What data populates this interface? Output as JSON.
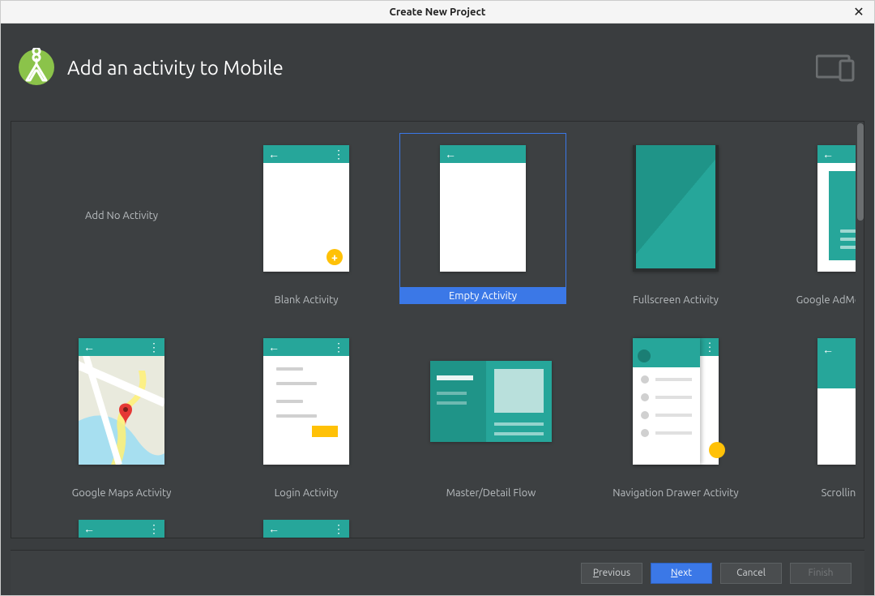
{
  "window": {
    "title": "Create New Project"
  },
  "header": {
    "title": "Add an activity to Mobile"
  },
  "templates": [
    {
      "key": "add_no_activity",
      "label": "Add No Activity",
      "selected": false
    },
    {
      "key": "blank",
      "label": "Blank Activity",
      "selected": false
    },
    {
      "key": "empty",
      "label": "Empty Activity",
      "selected": true
    },
    {
      "key": "fullscreen",
      "label": "Fullscreen Activity",
      "selected": false
    },
    {
      "key": "admob",
      "label": "Google AdMob Ads Activity",
      "selected": false
    },
    {
      "key": "maps",
      "label": "Google Maps Activity",
      "selected": false
    },
    {
      "key": "login",
      "label": "Login Activity",
      "selected": false
    },
    {
      "key": "master_detail",
      "label": "Master/Detail Flow",
      "selected": false
    },
    {
      "key": "nav_drawer",
      "label": "Navigation Drawer Activity",
      "selected": false
    },
    {
      "key": "scrolling",
      "label": "Scrolling Activity",
      "selected": false
    }
  ],
  "admob_label": "Ad",
  "buttons": {
    "previous": "Previous",
    "next": "Next",
    "cancel": "Cancel",
    "finish": "Finish"
  },
  "colors": {
    "accent": "#3b78e7",
    "teal": "#26a69a",
    "teal_dark": "#1f9488",
    "amber": "#ffc107",
    "panel": "#3d4042",
    "panel_dark": "#3a3d3f"
  }
}
